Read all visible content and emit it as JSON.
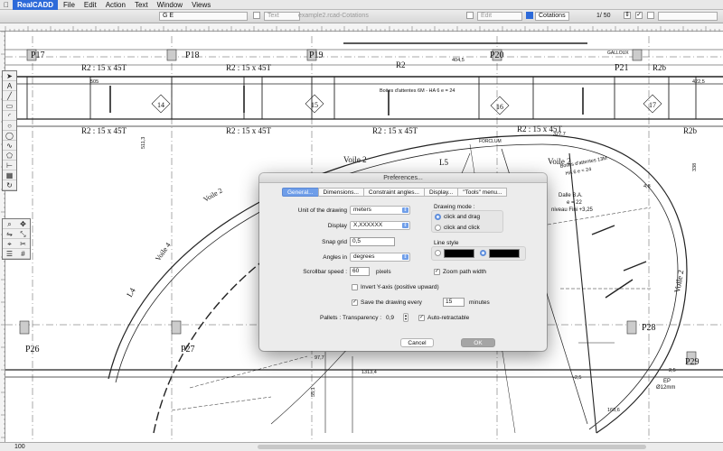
{
  "menubar": {
    "app_name": "RealCADD",
    "items": [
      "File",
      "Edit",
      "Action",
      "Text",
      "Window",
      "Views"
    ]
  },
  "titlebar": {
    "layer_field": "G E",
    "text_field": "Text",
    "edit_field": "Edit",
    "doc_title": "example2.rcad-Cotations",
    "view_name": "Cotations",
    "page": "1/  50"
  },
  "statusbar": {
    "zoom": "100"
  },
  "drawing": {
    "labels_pillars": [
      "P17",
      "P18",
      "P19",
      "P20",
      "P21",
      "P26",
      "P27",
      "P28",
      "P29"
    ],
    "beam_label": "R2 : 15 x 45T",
    "beam_label_short": "R2",
    "beam_label_b": "R2b",
    "boxes": [
      "14",
      "15",
      "16",
      "17"
    ],
    "walls": [
      "Voile 2",
      "Voile 2",
      "Voile 2",
      "Voile 2",
      "Voile 4",
      "L4",
      "L5"
    ],
    "notes": [
      "Boites d'attentes 6M - HA 6 e = 24",
      "Boites d'attentes 13M",
      "HA 6 e = 24",
      "Dalle B.A.",
      "e = 22",
      "niveau Fini +3,25",
      "GALLOUX",
      "FORCLUM"
    ],
    "dims": [
      "505",
      "422,5",
      "511,3",
      "404,5",
      "1313,4",
      "97,7",
      "55,1",
      "-2,5",
      "327,7",
      "2,5",
      "338",
      "160,6",
      "4,8",
      "Ø12mm",
      "EP"
    ]
  },
  "dialog": {
    "title": "Preferences...",
    "tabs": [
      "General...",
      "Dimensions...",
      "Constraint angles...",
      "Display...",
      "\"Tools\" menu..."
    ],
    "unit_label": "Unit of the drawing",
    "unit_value": "meters",
    "display_label": "Display",
    "display_value": "X,XXXXXX",
    "snap_label": "Snap grid",
    "snap_value": "0,5",
    "angles_label": "Angles in",
    "angles_value": "degrees",
    "scroll_label": "Scrollbar speed :",
    "scroll_value": "60",
    "scroll_unit": "pixels",
    "invert_label": "Invert Y-axis (positive upward)",
    "save_label": "Save the drawing every",
    "save_value": "15",
    "save_unit": "minutes",
    "pallets_label": "Pallets :",
    "transparency_label": "Transparency :",
    "transparency_value": "0,9",
    "autoretract_label": "Auto-retractable",
    "drawing_mode_label": "Drawing mode :",
    "mode_drag": "click and drag",
    "mode_click": "click and click",
    "line_style_label": "Line style",
    "zoom_path_label": "Zoom path width",
    "cancel_label": "Cancel",
    "ok_label": "OK"
  }
}
